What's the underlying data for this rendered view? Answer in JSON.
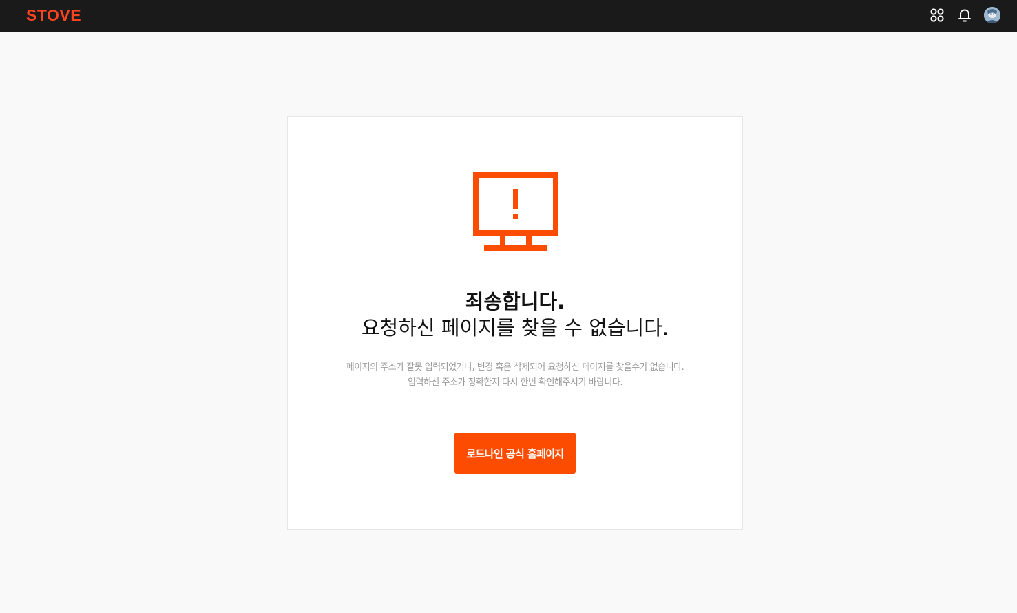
{
  "header": {
    "logo_text": "STOVE",
    "brand_color": "#fc4420",
    "icons": [
      "apps-grid-icon",
      "bell-icon",
      "user-avatar"
    ]
  },
  "error": {
    "icon": "monitor-warning-icon",
    "accent_color": "#fc4c02",
    "title": "죄송합니다.",
    "subtitle": "요청하신 페이지를 찾을 수 없습니다.",
    "description_line1": "페이지의 주소가 잘못 입력되었거나, 변경 혹은 삭제되어 요청하신 페이지를 찾을수가 없습니다.",
    "description_line2": "입력하신 주소가 정확한지 다시 한번 확인해주시기 바랍니다.",
    "button_label": "로드나인 공식 홈페이지"
  }
}
